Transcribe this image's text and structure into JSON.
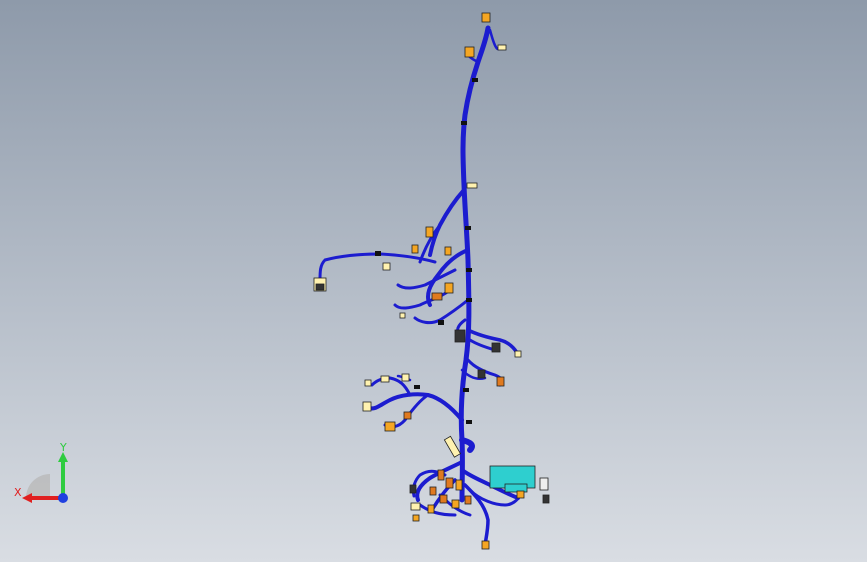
{
  "viewport": {
    "background_top": "#8e9aaa",
    "background_bottom": "#d9dde3",
    "model": {
      "wire_color": "#1c1ccf",
      "connector_colors": [
        "#f5a623",
        "#e07a1f",
        "#fff2b0",
        "#2ecfcf"
      ]
    }
  },
  "triad": {
    "x_label": "X",
    "y_label": "Y",
    "x_color": "#e02020",
    "y_color": "#2ecc40",
    "z_color": "#2040e0"
  }
}
